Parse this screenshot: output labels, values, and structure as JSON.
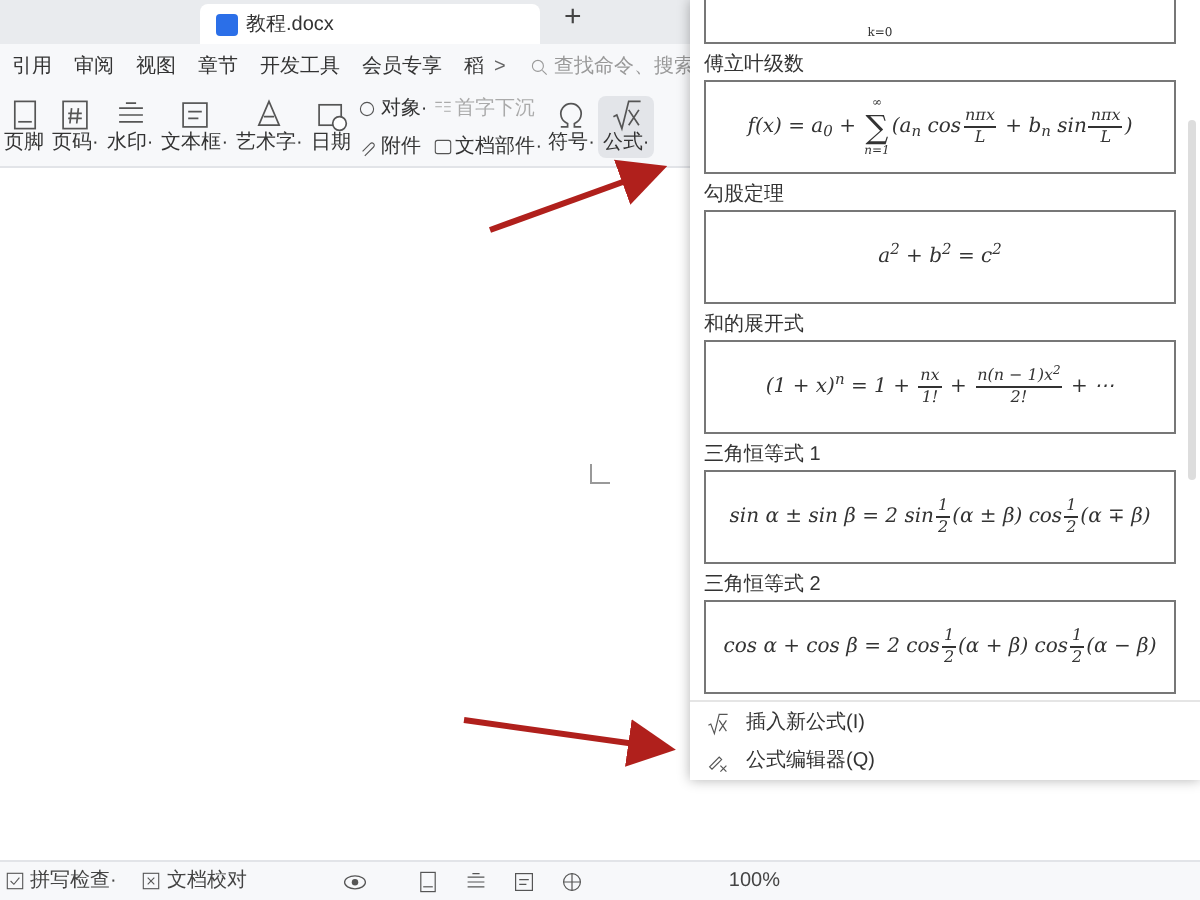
{
  "tabs": [
    {
      "label": "教程.docx",
      "selected": true
    }
  ],
  "new_tab": "+",
  "menu": [
    {
      "label": "引用"
    },
    {
      "label": "审阅"
    },
    {
      "label": "视图"
    },
    {
      "label": "章节"
    },
    {
      "label": "开发工具"
    },
    {
      "label": "会员专享"
    },
    {
      "label": "稻"
    }
  ],
  "more_arrow": ">",
  "search": {
    "placeholder": "查找命令、搜索"
  },
  "toolbar": [
    {
      "kind": "big",
      "label": "页脚"
    },
    {
      "kind": "big",
      "label": "页码·"
    },
    {
      "kind": "big",
      "label": "水印·"
    },
    {
      "kind": "big",
      "label": "文本框·"
    },
    {
      "kind": "big",
      "label": "艺术字·"
    },
    {
      "kind": "big",
      "label": "日期"
    },
    {
      "kind": "small",
      "items": [
        {
          "label": "对象·",
          "disabled": false
        },
        {
          "label": "附件",
          "disabled": false
        }
      ]
    },
    {
      "kind": "small",
      "items": [
        {
          "label": "首字下沉",
          "disabled": true
        },
        {
          "label": "文档部件·",
          "disabled": false
        }
      ]
    },
    {
      "kind": "big",
      "label": "符号·"
    },
    {
      "kind": "big",
      "label": "公式·",
      "selected": true
    }
  ],
  "formulas": [
    {
      "parts": [
        {
          "kind": "text",
          "text": "k=0"
        }
      ]
    },
    {
      "label": "傅立叶级数",
      "parts": [
        {
          "kind": "text",
          "text": "f(x) = a$_{0}$ + "
        },
        {
          "kind": "sum",
          "symbol": "∑",
          "top": "∞",
          "bottom": "n=1"
        },
        {
          "kind": "text",
          "text": "(a$_{n}$ cos"
        },
        {
          "kind": "frac",
          "num": "nπx",
          "den": "L"
        },
        {
          "kind": "text",
          "text": " + b$_{n}$ sin"
        },
        {
          "kind": "frac",
          "num": "nπx",
          "den": "L"
        },
        {
          "kind": "text",
          "text": ")"
        }
      ]
    },
    {
      "label": "勾股定理",
      "parts": [
        {
          "kind": "text",
          "text": "a$^{2}$ + b$^{2}$ = c$^{2}$"
        }
      ]
    },
    {
      "label": "和的展开式",
      "parts": [
        {
          "kind": "text",
          "text": "(1 + x)$^{n}$ = 1 + "
        },
        {
          "kind": "frac",
          "num": "nx",
          "den": "1!"
        },
        {
          "kind": "text",
          "text": " + "
        },
        {
          "kind": "frac",
          "num": "n(n − 1)x$^{2}$",
          "den": "2!"
        },
        {
          "kind": "text",
          "text": " + ⋯"
        }
      ]
    },
    {
      "label": "三角恒等式 1",
      "parts": [
        {
          "kind": "text",
          "text": "sin α ± sin β = 2 sin"
        },
        {
          "kind": "frac",
          "num": "1",
          "den": "2"
        },
        {
          "kind": "text",
          "text": "(α ± β) cos"
        },
        {
          "kind": "frac",
          "num": "1",
          "den": "2"
        },
        {
          "kind": "text",
          "text": "(α ∓ β)"
        }
      ]
    },
    {
      "label": "三角恒等式 2",
      "parts": [
        {
          "kind": "text",
          "text": "cos α + cos β = 2 cos"
        },
        {
          "kind": "frac",
          "num": "1",
          "den": "2"
        },
        {
          "kind": "text",
          "text": "(α + β) cos"
        },
        {
          "kind": "frac",
          "num": "1",
          "den": "2"
        },
        {
          "kind": "text",
          "text": "(α − β)"
        }
      ]
    }
  ],
  "panel_actions": [
    {
      "label": "插入新公式(I)"
    },
    {
      "label": "公式编辑器(Q)"
    }
  ],
  "status_bar": {
    "left": [
      {
        "label": "拼写检查·"
      },
      {
        "label": "文档校对"
      }
    ],
    "zoom": "100%"
  }
}
